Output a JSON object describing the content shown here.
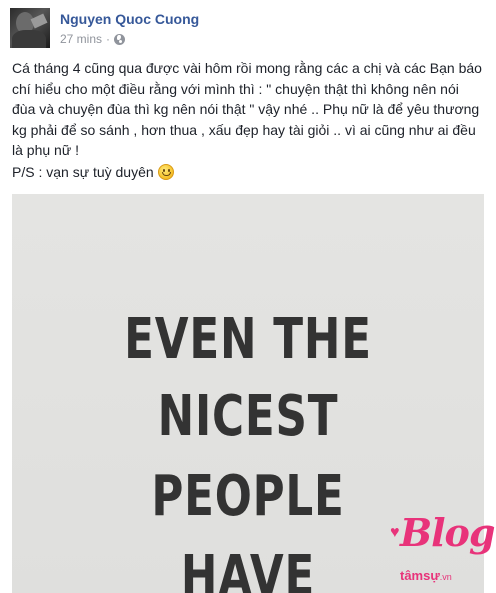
{
  "post": {
    "author": "Nguyen Quoc Cuong",
    "time": "27 mins",
    "separator": "·",
    "privacy_icon": "globe-icon",
    "body": "Cá tháng 4 cũng qua được vài hôm rồi mong rằng các a chị và các Bạn báo chí hiểu cho một điều rằng với mình thì : \" chuyện thật thì không nên nói đùa và chuyện đùa thì kg nên nói thật \" vậy nhé .. Phụ nữ là để yêu thương kg phải để so sánh , hơn thua , xấu đẹp hay tài giỏi .. vì ai cũng như ai đều là phụ nữ !",
    "ps": "P/S : vạn sự tuỳ duyên",
    "emoji_icon": "smile-icon"
  },
  "photo": {
    "lines": [
      "EVEN THE",
      "NICEST",
      "PEOPLE",
      "HAVE"
    ]
  },
  "watermark": {
    "logo": "Blog",
    "sub": "tâmsự",
    "suffix": ".vn"
  },
  "colors": {
    "author": "#365899",
    "meta": "#90949c",
    "quote_text": "#333333",
    "photo_bg": "#e2e2e0",
    "watermark": "#e8337a"
  }
}
